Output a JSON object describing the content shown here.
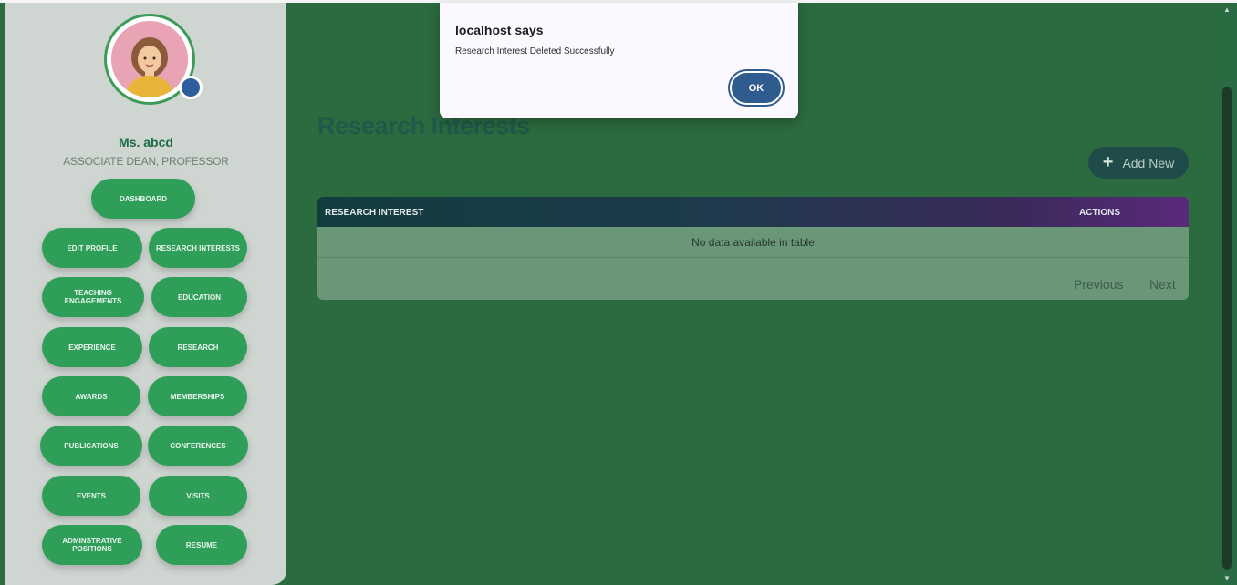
{
  "user": {
    "name": "Ms. abcd",
    "role": "ASSOCIATE DEAN, PROFESSOR"
  },
  "nav": {
    "dashboard": "DASHBOARD",
    "items": [
      "EDIT PROFILE",
      "RESEARCH INTERESTS",
      "TEACHING ENGAGEMENTS",
      "EDUCATION",
      "EXPERIENCE",
      "RESEARCH",
      "AWARDS",
      "MEMBERSHIPS",
      "PUBLICATIONS",
      "CONFERENCES",
      "EVENTS",
      "VISITS",
      "ADMINSTRATIVE POSITIONS",
      "RESUME"
    ]
  },
  "main": {
    "title": "Research Interests",
    "add_button": "Add New",
    "table": {
      "columns": [
        "RESEARCH INTEREST",
        "ACTIONS"
      ],
      "empty_message": "No data available in table"
    },
    "pager": {
      "previous": "Previous",
      "next": "Next"
    }
  },
  "dialog": {
    "title": "localhost says",
    "message": "Research Interest Deleted Successfully",
    "ok": "OK"
  },
  "colors": {
    "page_bg": "#2c6a3f",
    "sidebar_bg": "#cfd5d1",
    "nav_button": "#2f9e58",
    "ok_button": "#2f5b8e",
    "table_header_start": "#123d3e",
    "table_header_end": "#5a2a7a"
  },
  "icons": {
    "add": "plus-icon",
    "avatar": "user-avatar",
    "badge": "camera-badge-icon"
  }
}
